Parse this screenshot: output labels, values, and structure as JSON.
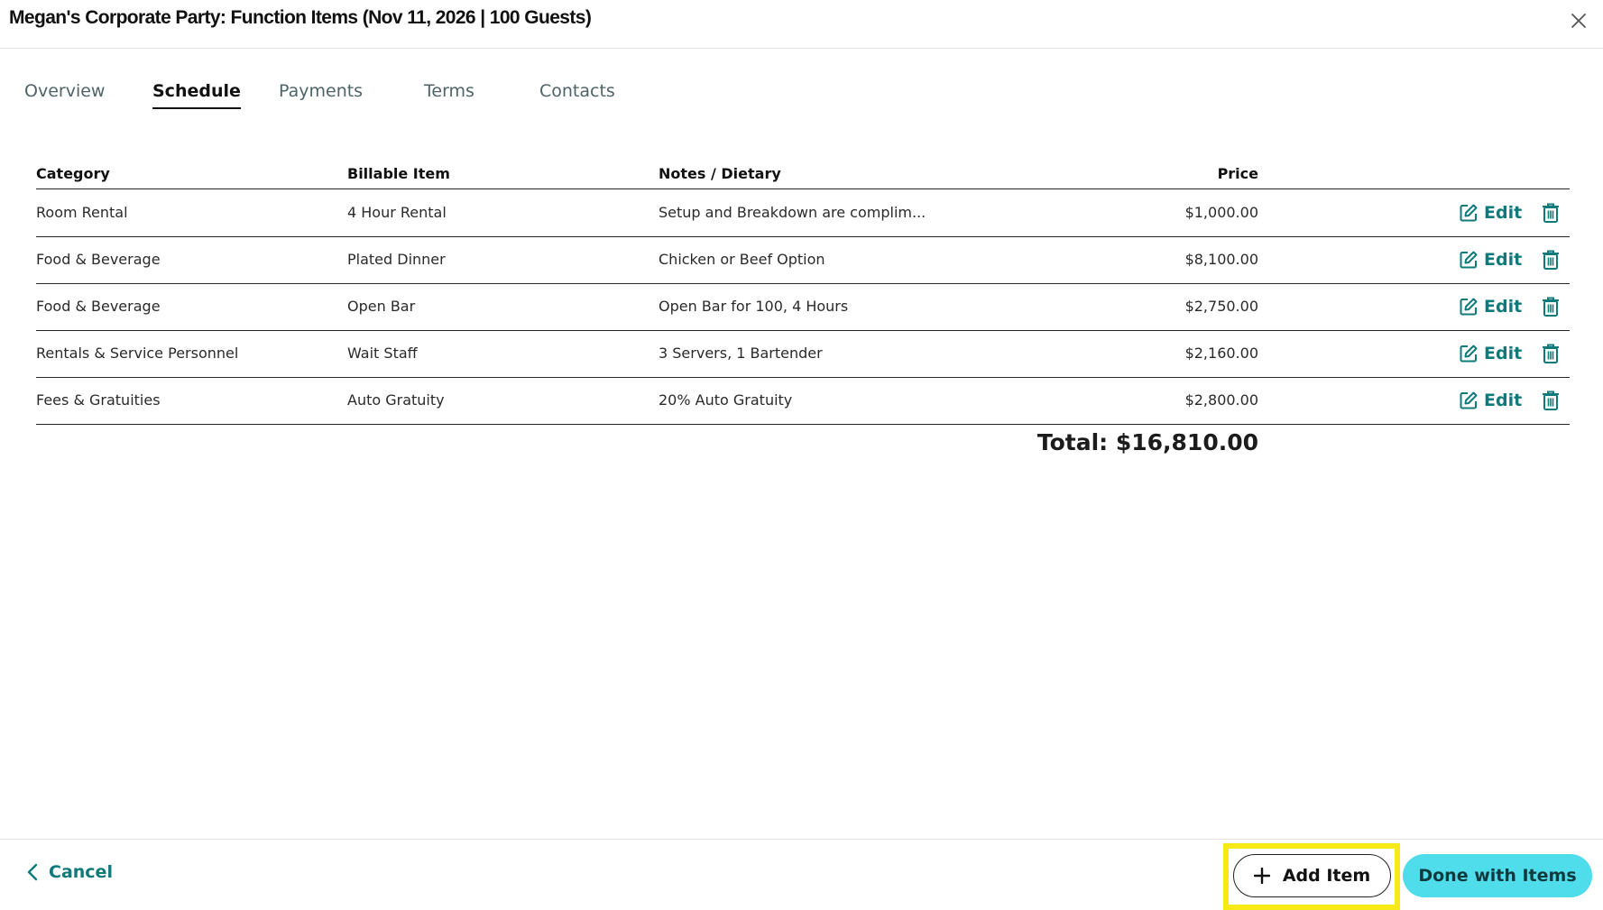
{
  "header": {
    "title": "Megan's Corporate Party: Function Items (Nov 11, 2026 | 100 Guests)"
  },
  "tabs": [
    {
      "label": "Overview",
      "active": false
    },
    {
      "label": "Schedule",
      "active": true
    },
    {
      "label": "Payments",
      "active": false
    },
    {
      "label": "Terms",
      "active": false
    },
    {
      "label": "Contacts",
      "active": false
    }
  ],
  "table": {
    "columns": [
      "Category",
      "Billable Item",
      "Notes / Dietary",
      "Price"
    ],
    "rows": [
      {
        "category": "Room Rental",
        "item": "4 Hour Rental",
        "notes": "Setup and Breakdown are complim...",
        "price": "$1,000.00"
      },
      {
        "category": "Food & Beverage",
        "item": "Plated Dinner",
        "notes": "Chicken or Beef Option",
        "price": "$8,100.00"
      },
      {
        "category": "Food & Beverage",
        "item": "Open Bar",
        "notes": "Open Bar for 100, 4 Hours",
        "price": "$2,750.00"
      },
      {
        "category": "Rentals & Service Personnel",
        "item": "Wait Staff",
        "notes": "3 Servers, 1 Bartender",
        "price": "$2,160.00"
      },
      {
        "category": "Fees & Gratuities",
        "item": "Auto Gratuity",
        "notes": "20% Auto Gratuity",
        "price": "$2,800.00"
      }
    ],
    "edit_label": "Edit",
    "total": "Total: $16,810.00"
  },
  "footer": {
    "cancel_label": "Cancel",
    "add_item_label": "Add Item",
    "done_label": "Done with Items"
  },
  "colors": {
    "accent_teal": "#0e7a7a",
    "done_button_bg": "#4fdceb",
    "highlight": "#f7e916"
  },
  "icons": {
    "close": "close-icon",
    "edit": "edit-icon",
    "delete": "trash-icon",
    "back": "chevron-left-icon",
    "add": "plus-icon"
  }
}
